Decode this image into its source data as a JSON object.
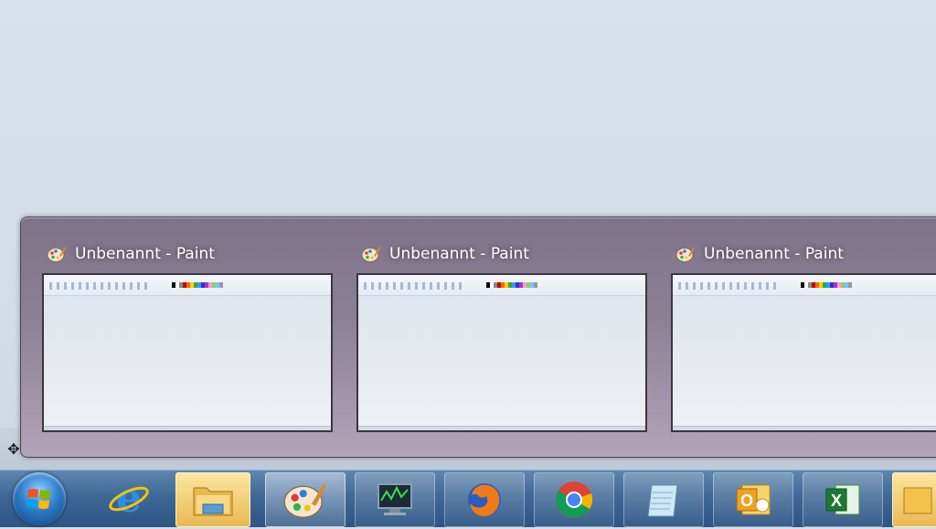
{
  "flyout": {
    "thumbnails": [
      {
        "title": "Unbenannt - Paint",
        "icon": "paint-icon"
      },
      {
        "title": "Unbenannt - Paint",
        "icon": "paint-icon"
      },
      {
        "title": "Unbenannt - Paint",
        "icon": "paint-icon"
      }
    ]
  },
  "taskbar": {
    "items": [
      {
        "name": "start-button",
        "icon": "windows-logo-icon"
      },
      {
        "name": "internet-explorer",
        "icon": "internet-explorer-icon"
      },
      {
        "name": "windows-explorer",
        "icon": "folder-icon"
      },
      {
        "name": "paint",
        "icon": "paint-icon"
      },
      {
        "name": "task-manager",
        "icon": "monitor-icon"
      },
      {
        "name": "firefox",
        "icon": "firefox-icon"
      },
      {
        "name": "chrome",
        "icon": "chrome-icon"
      },
      {
        "name": "notepad",
        "icon": "notepad-icon"
      },
      {
        "name": "outlook",
        "icon": "outlook-icon"
      },
      {
        "name": "excel",
        "icon": "excel-icon"
      },
      {
        "name": "overflow-app",
        "icon": "app-icon"
      }
    ]
  },
  "colors": {
    "desktop": "#d5deea",
    "flyout_top": "#7e7389",
    "flyout_bottom": "#b2a4b9",
    "taskbar": "#3f6896"
  }
}
